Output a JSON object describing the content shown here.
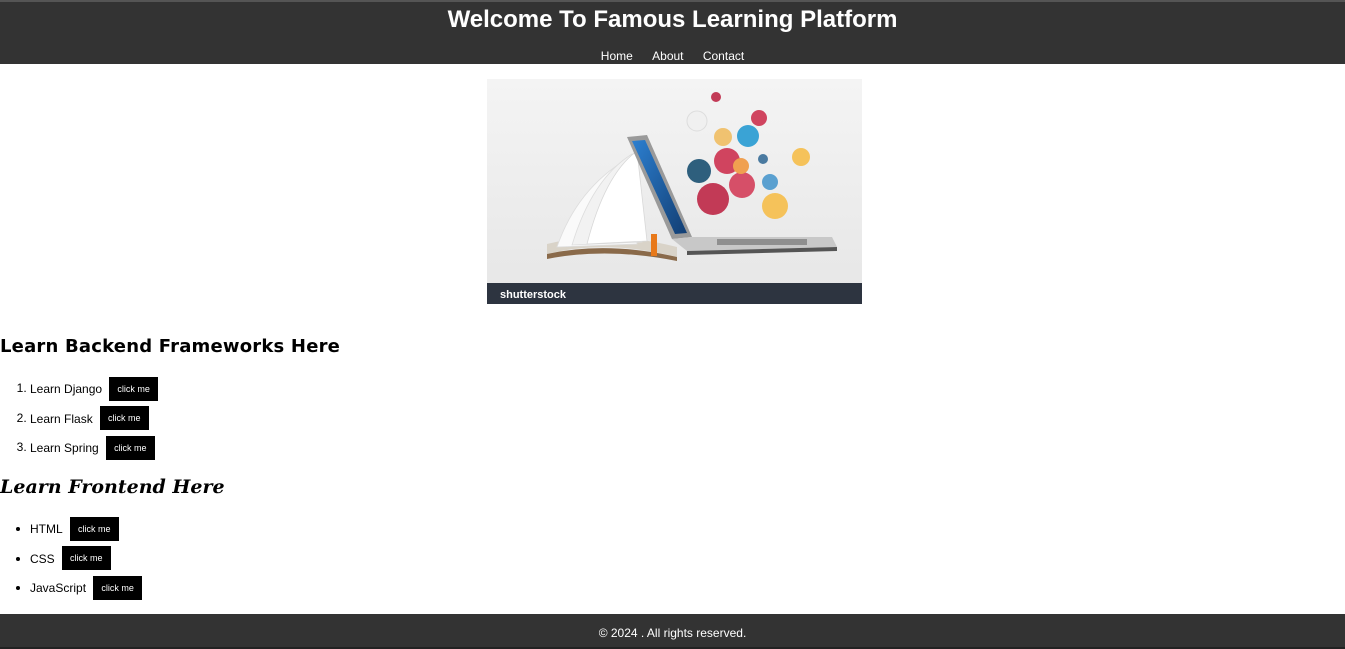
{
  "header": {
    "title": "Welcome To Famous Learning Platform",
    "nav": [
      "Home",
      "About",
      "Contact"
    ]
  },
  "hero": {
    "watermark": "shutterstock"
  },
  "backend": {
    "heading": "Learn Backend Frameworks Here",
    "items": [
      {
        "label": "Learn Django",
        "button": "click me"
      },
      {
        "label": "Learn Flask",
        "button": "click me"
      },
      {
        "label": "Learn Spring",
        "button": "click me"
      }
    ]
  },
  "frontend": {
    "heading": "Learn Frontend Here",
    "items": [
      {
        "label": "HTML",
        "button": "click me"
      },
      {
        "label": "CSS",
        "button": "click me"
      },
      {
        "label": "JavaScript",
        "button": "click me"
      }
    ]
  },
  "footer": {
    "text": "© 2024 . All rights reserved."
  },
  "colors": {
    "header_bg": "#333333",
    "button_bg": "#000000",
    "text": "#ffffff"
  }
}
